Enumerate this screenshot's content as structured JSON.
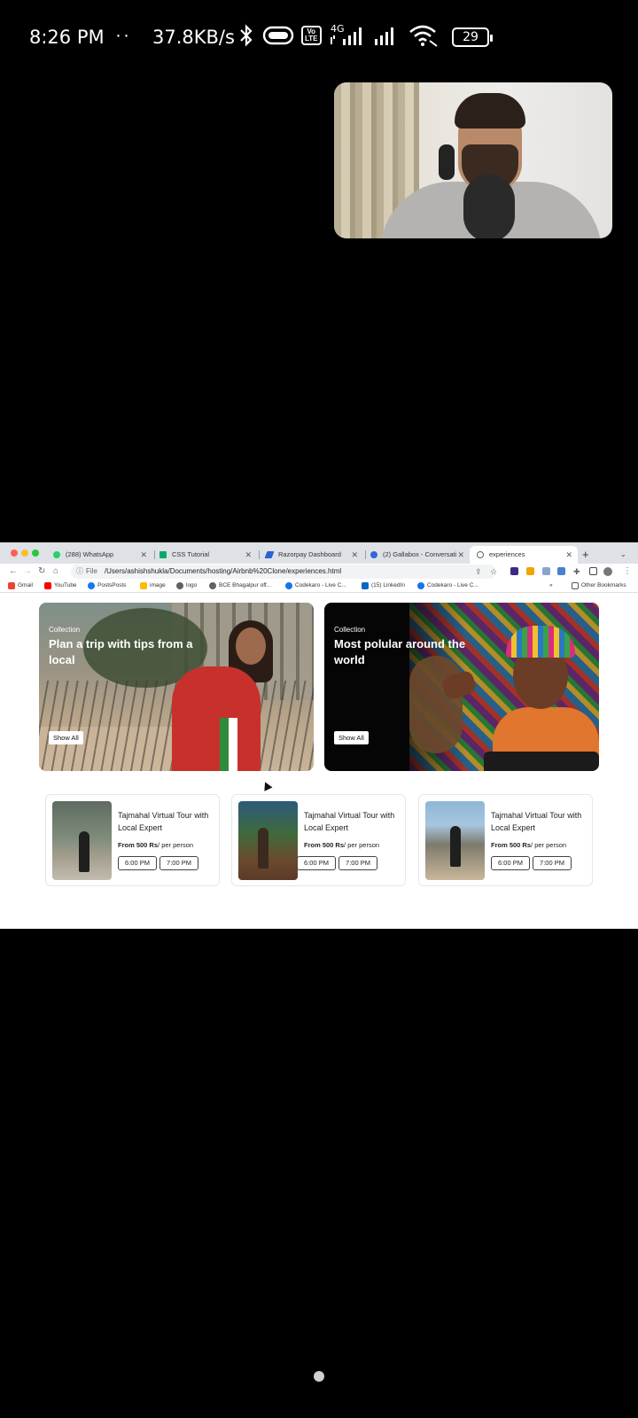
{
  "status_bar": {
    "time": "8:26 PM",
    "dots": "··",
    "net_speed": "37.8KB/s",
    "network_label": "4G",
    "volte_label": "Vo\nLTE",
    "battery": "29",
    "icons": [
      "bluetooth-icon",
      "toggle-icon",
      "volte-icon",
      "signal-icon",
      "signal-icon",
      "wifi-icon",
      "battery-icon"
    ]
  },
  "browser": {
    "tabs": [
      {
        "label": "(288) WhatsApp",
        "favicon_color": "#25d366"
      },
      {
        "label": "CSS Tutorial",
        "favicon_color": "#04aa6d"
      },
      {
        "label": "Razorpay Dashboard",
        "favicon_color": "#2b61d1"
      },
      {
        "label": "(2) Gallabox - Conversati",
        "favicon_color": "#3367d6"
      },
      {
        "label": "experiences",
        "favicon_color": "#5f6368"
      }
    ],
    "url_scheme": "File",
    "url": "/Users/ashishshukla/Documents/hosting/Airbnb%20Clone/experiences.html",
    "bookmarks": [
      {
        "label": "Gmail",
        "color": "#ea4335"
      },
      {
        "label": "YouTube",
        "color": "#ff0000"
      },
      {
        "label": "PostsPosts",
        "color": "#1877f2"
      },
      {
        "label": "image",
        "color": "#fbbc04"
      },
      {
        "label": "logo",
        "color": "#5f6368"
      },
      {
        "label": "BCE Bhagalpur off...",
        "color": "#5f6368"
      },
      {
        "label": "Codekaro - Live C...",
        "color": "#1a73e8"
      },
      {
        "label": "(15) LinkedIn",
        "color": "#0a66c2"
      },
      {
        "label": "Codekaro - Live C...",
        "color": "#1a73e8"
      }
    ],
    "bookmarks_overflow": "»",
    "other_bookmarks": "Other Bookmarks"
  },
  "page": {
    "heroes": [
      {
        "kicker": "Collection",
        "title": "Plan a trip with tips from a local",
        "button": "Show All"
      },
      {
        "kicker": "Collection",
        "title": "Most polular around the world",
        "button": "Show All"
      }
    ],
    "cards": [
      {
        "title": "Tajmahal Virtual Tour with Local Expert",
        "price_bold": "From 500 Rs",
        "price_rest": "/ per person",
        "slots": [
          "6:00 PM",
          "7:00 PM"
        ]
      },
      {
        "title": "Tajmahal Virtual Tour with Local Expert",
        "price_bold": "From 500 Rs",
        "price_rest": "/ per person",
        "slots": [
          "6:00 PM",
          "7:00 PM"
        ]
      },
      {
        "title": "Tajmahal Virtual Tour with Local Expert",
        "price_bold": "From 500 Rs",
        "price_rest": "/ per person",
        "slots": [
          "6:00 PM",
          "7:00 PM"
        ]
      }
    ]
  }
}
